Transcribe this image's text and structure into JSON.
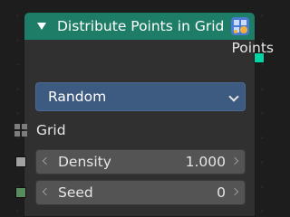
{
  "node": {
    "title": "Distribute Points in Grid",
    "header_color": "#1e7d66",
    "icon": "geometry-grid-icon"
  },
  "outputs": [
    {
      "label": "Points",
      "socket_color": "#00d6a3"
    }
  ],
  "mode_dropdown": {
    "value": "Random"
  },
  "inputs": {
    "grid": {
      "label": "Grid",
      "socket_color": "#7d7d7d"
    },
    "density": {
      "label": "Density",
      "value": "1.000",
      "socket_color": "#a1a1a1"
    },
    "seed": {
      "label": "Seed",
      "value": "0",
      "socket_color": "#598c5c"
    }
  }
}
